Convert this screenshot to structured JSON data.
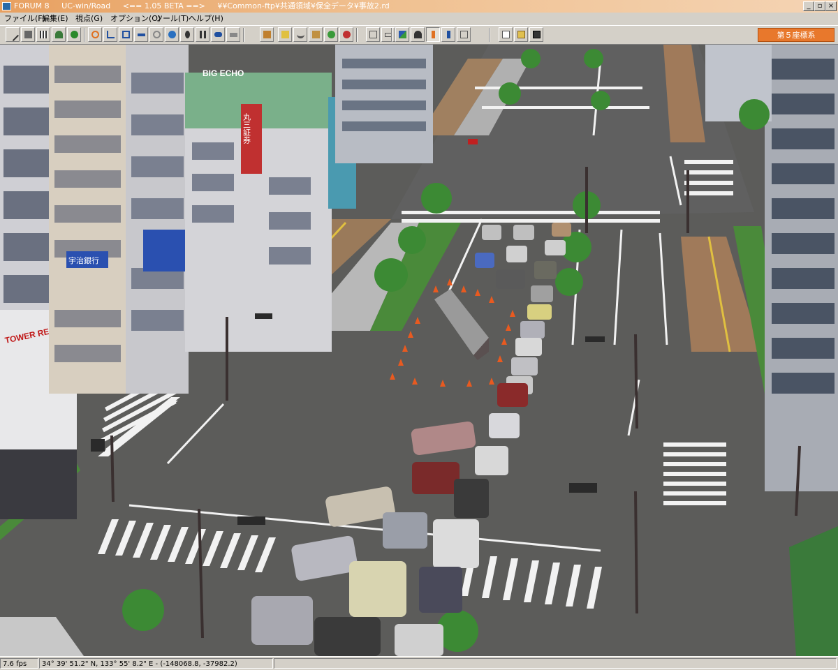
{
  "window": {
    "app_name": "FORUM 8",
    "product": "UC-win/Road",
    "version": "<== 1.05 BETA ==>",
    "file_path": "¥¥Common-ftp¥共通領域¥保全データ¥事故2.rd",
    "minimize_icon": "minimize-icon",
    "restore_icon": "restore-icon",
    "close_icon": "close-icon"
  },
  "menu": {
    "file": "ファイル(F)",
    "edit": "編集(E)",
    "view": "視点(G)",
    "options": "オプション(O)",
    "tools": "ツール(T)",
    "help": "ヘルプ(H)"
  },
  "toolbar": {
    "coordinate_system": "第５座標系",
    "active_tool": "walk-view-icon",
    "accent_color": "#e8782c"
  },
  "scene": {
    "signs": {
      "big_echo": "BIG ECHO",
      "securities": "丸三証券",
      "bank": "宇治銀行",
      "tower_records": "TOWER RECORDS"
    },
    "accident": "overturned truck surrounded by traffic cones"
  },
  "status": {
    "fps": "7.6 fps",
    "geo_position": "34° 39' 51.2\" N, 133° 55' 8.2\" E - (-148068.8, -37982.2)",
    "panel_3": ""
  }
}
